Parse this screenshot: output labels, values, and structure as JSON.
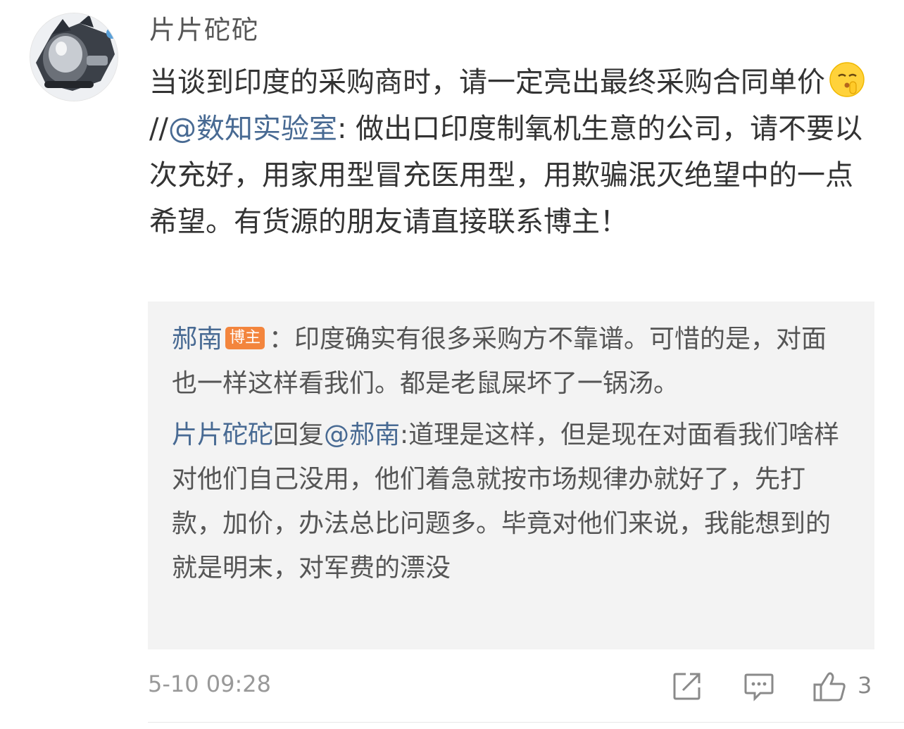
{
  "comment": {
    "username": "片片砣砣",
    "text_before_emoji": "当谈到印度的采购商时，请一定亮出最终采购合同单价",
    "emoji": "shush-emoji",
    "repost_prefix": "//",
    "mention": "@数知实验室",
    "text_after_mention": ": 做出口印度制氧机生意的公司，请不要以次充好，用家用型冒充医用型，用欺骗泯灭绝望中的一点希望。有货源的朋友请直接联系博主！"
  },
  "replies": [
    {
      "author": "郝南",
      "badge": "博主",
      "text": "：印度确实有很多采购方不靠谱。可惜的是，对面也一样这样看我们。都是老鼠屎坏了一锅汤。"
    },
    {
      "author": "片片砣砣",
      "reply_word": "回复",
      "mention": "@郝南",
      "text": ":道理是这样，但是现在对面看我们啥样对他们自己没用，他们着急就按市场规律办就好了，先打款，加价，办法总比问题多。毕竟对他们来说，我能想到的就是明末，对军费的漂没"
    }
  ],
  "footer": {
    "timestamp": "5-10 09:28",
    "like_count": "3"
  },
  "colors": {
    "link": "#486a93",
    "badge": "#f3853d",
    "reply_background": "#f3f3f3"
  }
}
